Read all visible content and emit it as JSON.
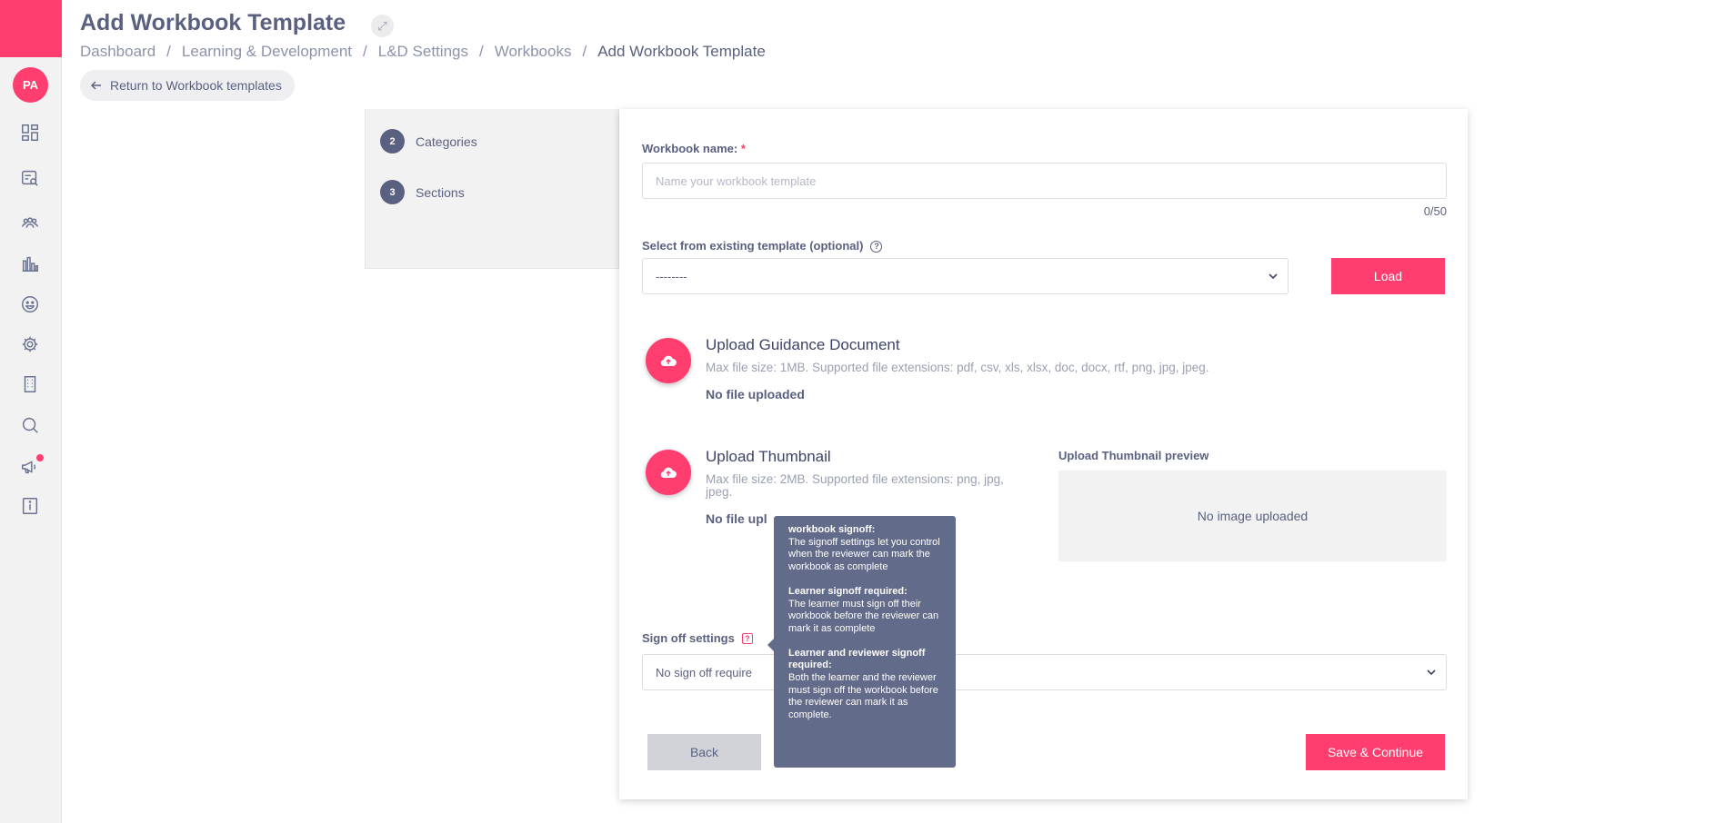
{
  "sidebar": {
    "avatar_initials": "PA",
    "icons": [
      "dashboard-icon",
      "search-document-icon",
      "people-icon",
      "bar-chart-icon",
      "smiley-icon",
      "gear-icon",
      "building-icon",
      "search-icon",
      "megaphone-icon",
      "info-icon"
    ]
  },
  "header": {
    "title": "Add Workbook Template",
    "breadcrumb": [
      "Dashboard",
      "Learning & Development",
      "L&D Settings",
      "Workbooks",
      "Add Workbook Template"
    ],
    "return_label": "Return to Workbook templates"
  },
  "steps": [
    {
      "number": "2",
      "label": "Categories"
    },
    {
      "number": "3",
      "label": "Sections"
    }
  ],
  "form": {
    "name_label": "Workbook name:",
    "name_required_mark": "*",
    "name_placeholder": "Name your workbook template",
    "name_counter": "0/50",
    "template_label": "Select from existing template (optional)",
    "template_help": "?",
    "template_value": "--------",
    "load_label": "Load",
    "guidance": {
      "title": "Upload Guidance Document",
      "desc": "Max file size: 1MB. Supported file extensions: pdf, csv, xls, xlsx, doc, docx, rtf, png, jpg, jpeg.",
      "status": "No file uploaded"
    },
    "thumbnail": {
      "title": "Upload Thumbnail",
      "desc": "Max file size: 2MB. Supported file extensions: png, jpg, jpeg.",
      "status": "No file upl",
      "preview_label": "Upload Thumbnail preview",
      "preview_empty": "No image uploaded"
    },
    "signoff_label": "Sign off settings",
    "signoff_help": "?",
    "signoff_value": "No sign off require",
    "back_label": "Back",
    "save_label": "Save & Continue"
  },
  "tooltip": {
    "b1_head": "workbook signoff:",
    "b1_body": "The signoff settings let you control when the reviewer can mark the workbook as complete",
    "b2_head": "Learner signoff required:",
    "b2_body": "The learner must sign off their workbook before the reviewer can mark it as complete",
    "b3_head": "Learner and reviewer signoff required:",
    "b3_body": "Both the learner and the reviewer must sign off the workbook before the reviewer can mark it as complete."
  },
  "colors": {
    "accent": "#ff3d6e",
    "text": "#5a6180",
    "tooltip_bg": "#636b8a"
  }
}
